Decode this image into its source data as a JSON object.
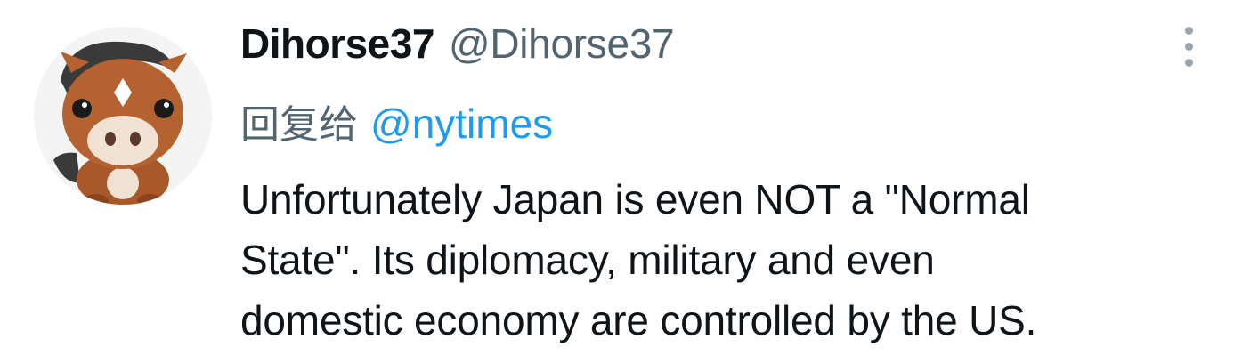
{
  "tweet": {
    "display_name": "Dihorse37",
    "handle": "@Dihorse37",
    "reply_prefix": "回复给",
    "reply_target": "@nytimes",
    "body_lines": [
      "Unfortunately Japan is even NOT a \"Normal",
      "State\". Its diplomacy, military and even",
      "domestic economy are controlled by the US."
    ],
    "avatar_icon": "horse-avatar",
    "more_icon": "more-vertical-icon",
    "colors": {
      "text": "#0f1419",
      "secondary": "#536471",
      "link": "#1d9bf0"
    }
  }
}
